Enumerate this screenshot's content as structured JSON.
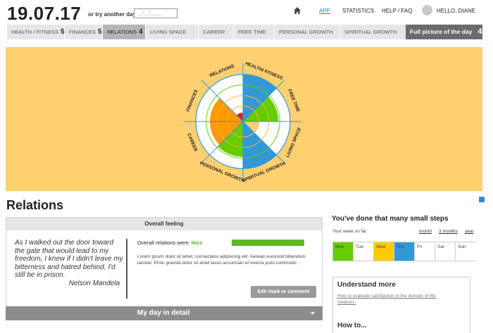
{
  "header": {
    "date": "19.07.17",
    "try_label": "or try another day",
    "date_placeholder": "__/__/____",
    "home_icon": "home-icon",
    "nav": [
      "APP",
      "STATISTICS",
      "HELP / FAQ"
    ],
    "greeting": "HELLO, DIANE"
  },
  "tabs": [
    {
      "label": "HEALTH / FITNESS",
      "count": "5"
    },
    {
      "label": "FINANCES",
      "count": "5"
    },
    {
      "label": "RELATIONS",
      "count": "4"
    },
    {
      "label": "LIVING SPACE",
      "count": ""
    },
    {
      "label": "CAREER",
      "count": ""
    },
    {
      "label": "FREE TIME",
      "count": ""
    },
    {
      "label": "PERSONAL GROWTH",
      "count": ""
    },
    {
      "label": "SPIRITUAL GROWTH",
      "count": ""
    }
  ],
  "full_picture": {
    "label": "Full picture of the day",
    "count": "4"
  },
  "wheel": {
    "segments": [
      {
        "label": "RELATIONS",
        "level": 0.19,
        "color": "#e31b1b"
      },
      {
        "label": "HEALTH/ FITNESS",
        "level": 1.0,
        "color": "#3399d6"
      },
      {
        "label": "FREE TIME",
        "level": 0.75,
        "color": "#66cc00"
      },
      {
        "label": "LIVING SPACE",
        "level": 0.33,
        "color": "#ffd070"
      },
      {
        "label": "SPIRITUAL GROWTH",
        "level": 1.0,
        "color": "#3399d6"
      },
      {
        "label": "PERSONAL GROWTH",
        "level": 0.75,
        "color": "#66cc00"
      },
      {
        "label": "CAREER",
        "level": 0.7,
        "color": "#ff9900"
      },
      {
        "label": "FINANCES",
        "level": 0.7,
        "color": "#ff9900"
      }
    ]
  },
  "relations": {
    "title": "Relations",
    "panel_head": "Overall feeling",
    "quote": "As I walked out the door toward the gate that would lead to my freedom, I knew if I didn't leave my bitterness and hatred behind, I'd still be in prison.",
    "quote_author": "Nelson Mandela",
    "feeling_label": "Overall relations were:",
    "feeling_value": "Nice",
    "feeling_level": 1.0,
    "feeling_color": "#5cb82a",
    "lorem": "Lorem ipsum dolor sit amet, consectetur adipiscing elit. Aenean euismod bibendum laoreet. Proin gravida dolor sit amet lacus accumsan et viverra justo commodo. .",
    "edit_button": "Edit mark or comment",
    "detail": "My day in detail"
  },
  "steps": {
    "title": "You've done that many small steps",
    "week_label": "Your week so far",
    "ranges": [
      "month",
      "3 months",
      "year"
    ],
    "days": [
      {
        "label": "Mon",
        "color": "#66cc00"
      },
      {
        "label": "Tue",
        "color": "#ffffff"
      },
      {
        "label": "Wed",
        "color": "#ffcc00"
      },
      {
        "label": "Thu",
        "color": "#3399d6"
      },
      {
        "label": "Fri",
        "color": "#ffffff"
      },
      {
        "label": "Sat",
        "color": "#ffffff"
      },
      {
        "label": "Sun",
        "color": "#ffffff"
      }
    ]
  },
  "understand": {
    "title": "Understand more",
    "link": "How to evaluate satisfaction in the domain of life: relations.",
    "howto": "How to..."
  }
}
